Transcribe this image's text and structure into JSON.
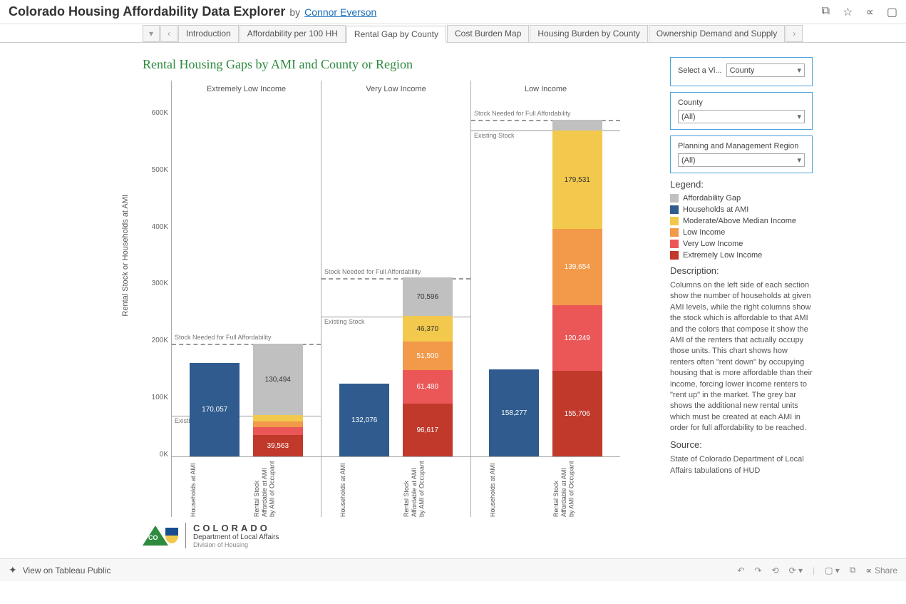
{
  "header": {
    "title": "Colorado Housing Affordability Data Explorer",
    "by": "by",
    "author": "Connor Everson"
  },
  "tabs": {
    "items": [
      "Introduction",
      "Affordability per 100 HH",
      "Rental Gap by County",
      "Cost Burden Map",
      "Housing Burden by County",
      "Ownership Demand and Supply"
    ],
    "active": 2
  },
  "chart_title": "Rental Housing Gaps by AMI and County or Region",
  "ylabel": "Rental Stock or Households at AMI",
  "yticks": [
    "600K",
    "500K",
    "400K",
    "300K",
    "200K",
    "100K",
    "0K"
  ],
  "panel_headers": [
    "Extremely Low Income",
    "Very Low Income",
    "Low Income"
  ],
  "ref": {
    "needed": "Stock Needed for Full Affordability",
    "existing": "Existing Stock"
  },
  "xlabs": {
    "left": "Households at AMI",
    "right": "Rental Stock Affordable at AMI by AMI of Occupant"
  },
  "chart_data": {
    "type": "bar",
    "ylabel": "Rental Stock or Households at AMI",
    "ylim": [
      0,
      650000
    ],
    "yticks": [
      0,
      100000,
      200000,
      300000,
      400000,
      500000,
      600000
    ],
    "facets": [
      "Extremely Low Income",
      "Very Low Income",
      "Low Income"
    ],
    "columns_per_facet": [
      "Households at AMI",
      "Rental Stock Affordable at AMI by AMI of Occupant"
    ],
    "series_stack": [
      "Extremely Low Income",
      "Very Low Income",
      "Low Income",
      "Moderate/Above Median Income",
      "Affordability Gap"
    ],
    "households_at_ami": {
      "Extremely Low Income": 170057,
      "Very Low Income": 132076,
      "Low Income": 158277
    },
    "rental_stock_stack": {
      "Extremely Low Income": {
        "Extremely Low Income": 39563,
        "Very Low Income": 14000,
        "Low Income": 10000,
        "Moderate/Above Median Income": 12000,
        "Affordability Gap": 130494,
        "Existing Stock": 75000,
        "Stock Needed": 206000
      },
      "Very Low Income": {
        "Extremely Low Income": 96617,
        "Very Low Income": 61480,
        "Low Income": 51500,
        "Moderate/Above Median Income": 46370,
        "Affordability Gap": 70596,
        "Existing Stock": 255967,
        "Stock Needed": 326563
      },
      "Low Income": {
        "Extremely Low Income": 155706,
        "Very Low Income": 120249,
        "Low Income": 139654,
        "Moderate/Above Median Income": 179531,
        "Affordability Gap": 20000,
        "Existing Stock": 595140,
        "Stock Needed": 615140
      }
    },
    "labels": {
      "p1_hh": "170,057",
      "p1_gap": "130,494",
      "p1_eli": "39,563",
      "p2_hh": "132,076",
      "p2_gap": "70,596",
      "p2_mod": "46,370",
      "p2_low": "51,500",
      "p2_vli": "61,480",
      "p2_eli": "96,617",
      "p3_hh": "158,277",
      "p3_mod": "179,531",
      "p3_low": "139,654",
      "p3_vli": "120,249",
      "p3_eli": "155,706"
    }
  },
  "logo": {
    "l1": "COLORADO",
    "l2": "Department of Local Affairs",
    "l3": "Division of Housing"
  },
  "filters": {
    "view_label": "Select a Vi...",
    "view_value": "County",
    "county_label": "County",
    "county_value": "(All)",
    "region_label": "Planning and Management Region",
    "region_value": "(All)"
  },
  "legend": {
    "header": "Legend:",
    "items": [
      {
        "name": "Affordability Gap",
        "color": "#c0c0c0"
      },
      {
        "name": "Households at AMI",
        "color": "#2f5b8f"
      },
      {
        "name": "Moderate/Above Median Income",
        "color": "#f2c94c"
      },
      {
        "name": "Low Income",
        "color": "#f2994a"
      },
      {
        "name": "Very Low Income",
        "color": "#eb5757"
      },
      {
        "name": "Extremely Low Income",
        "color": "#c0392b"
      }
    ]
  },
  "description": {
    "header": "Description:",
    "text": "Columns on the left side of each section show the number of households at given AMI levels, while the right columns show the stock which is affordable to that AMI and the colors that compose it show the AMI of the renters that actually occupy those units. This chart shows how renters often \"rent down\" by occupying housing that is more affordable than their income, forcing lower income renters to \"rent up\" in the market. The grey bar shows the additional new rental units which must be created at each AMI in order for full affordability to be reached."
  },
  "source": {
    "header": "Source:",
    "text": "State of Colorado Department of Local Affairs tabulations of HUD"
  },
  "footer": {
    "view": "View on Tableau Public",
    "share": "Share"
  }
}
